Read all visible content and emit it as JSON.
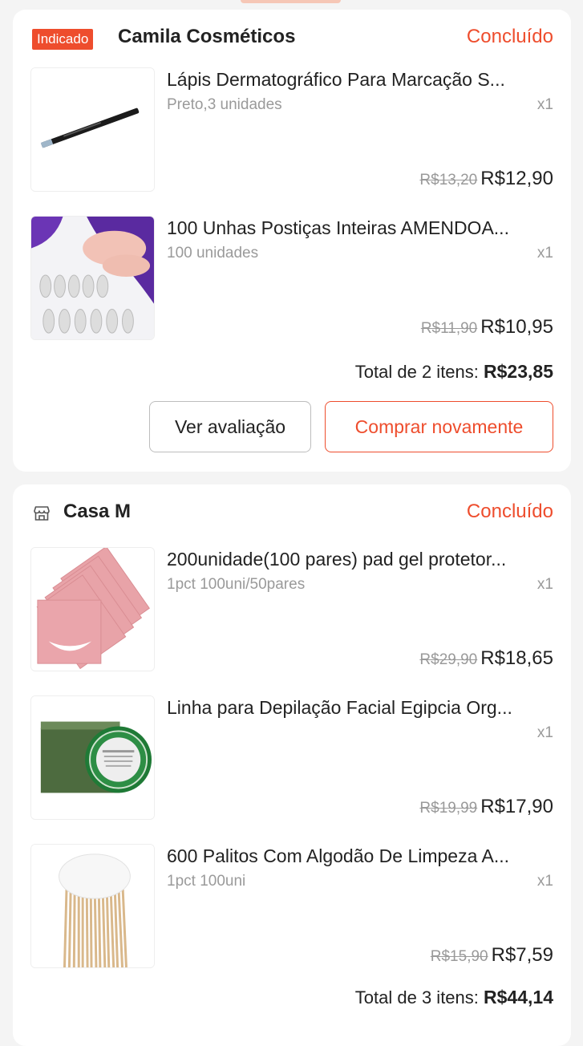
{
  "orders": [
    {
      "badge": "Indicado",
      "shop": "Camila Cosméticos",
      "status": "Concluído",
      "items": [
        {
          "title": "Lápis Dermatográfico Para Marcação S...",
          "variant": "Preto,3 unidades",
          "qty": "x1",
          "old_price": "R$13,20",
          "price": "R$12,90",
          "image_icon": "black-pencil-image"
        },
        {
          "title": "100 Unhas Postiças Inteiras AMENDOA...",
          "variant": "100 unidades",
          "qty": "x1",
          "old_price": "R$11,90",
          "price": "R$10,95",
          "image_icon": "false-nails-image"
        }
      ],
      "total_label": "Total de 2 itens:",
      "total_value": "R$23,85",
      "buttons": {
        "review": "Ver avaliação",
        "buy_again": "Comprar novamente"
      }
    },
    {
      "shop_icon": "store-icon",
      "shop": "Casa M",
      "status": "Concluído",
      "items": [
        {
          "title": "200unidade(100 pares) pad gel protetor...",
          "variant": "1pct 100uni/50pares",
          "qty": "x1",
          "old_price": "R$29,90",
          "price": "R$18,65",
          "image_icon": "pink-gel-pads-image"
        },
        {
          "title": "Linha para Depilação Facial Egipcia Org...",
          "variant": "",
          "qty": "x1",
          "old_price": "R$19,99",
          "price": "R$17,90",
          "image_icon": "thread-spool-box-image"
        },
        {
          "title": "600 Palitos Com Algodão De Limpeza A...",
          "variant": "1pct 100uni",
          "qty": "x1",
          "old_price": "R$15,90",
          "price": "R$7,59",
          "image_icon": "cotton-swabs-image"
        }
      ],
      "total_label": "Total de 3 itens:",
      "total_value": "R$44,14"
    }
  ],
  "colors": {
    "accent": "#ee4d2d",
    "background": "#f4f4f4",
    "muted": "#9a9a9a"
  }
}
